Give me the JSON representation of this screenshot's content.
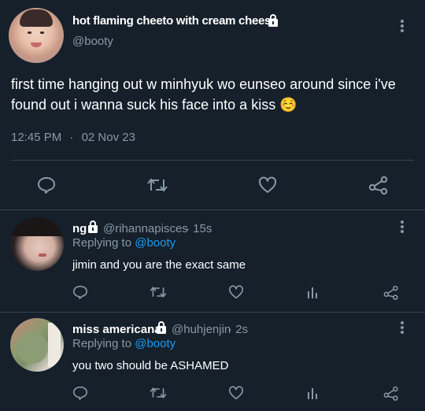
{
  "main_tweet": {
    "display_name": "hot flaming cheeto with cream cheese",
    "handle": "@booty",
    "text": "first time hanging out w minhyuk wo eunseo around since i've found out i wanna suck his face into a kiss ☺️",
    "time": "12:45 PM",
    "separator": "·",
    "date": "02 Nov 23"
  },
  "replies": [
    {
      "display_name": "ng",
      "handle": "@rihannapisces",
      "age": "· 15s",
      "replying_prefix": "Replying to",
      "replying_to": "@booty",
      "text": "jimin and you are the exact same"
    },
    {
      "display_name": "miss americana",
      "handle": "@huhjenjin",
      "age": "· 2s",
      "replying_prefix": "Replying to",
      "replying_to": "@booty",
      "text": "you two should be ASHAMED"
    }
  ],
  "colors": {
    "background": "#15202b",
    "divider": "#38444d",
    "muted": "#8899a6",
    "link": "#1d9bf0"
  },
  "icons": [
    "lock-icon",
    "more-options-icon",
    "reply-icon",
    "retweet-icon",
    "like-icon",
    "share-icon",
    "analytics-icon"
  ]
}
